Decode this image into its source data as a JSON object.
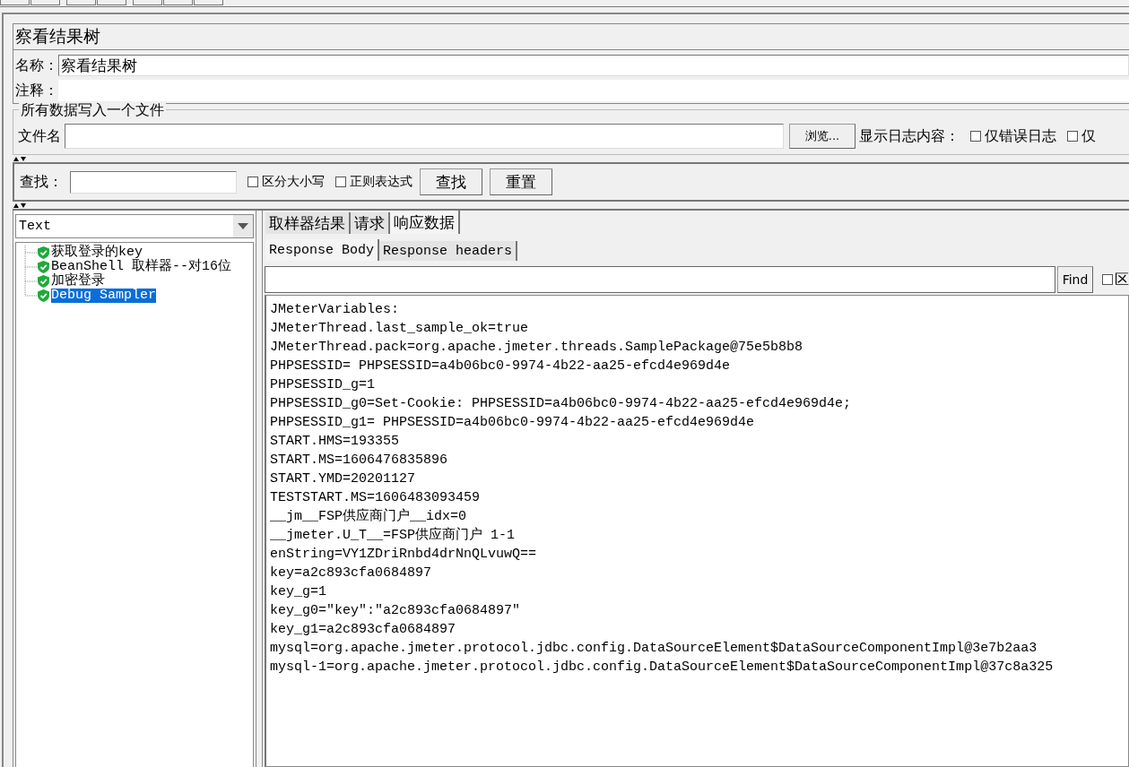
{
  "panel_title": "察看结果树",
  "name_field": {
    "label": "名称：",
    "value": "察看结果树"
  },
  "comment_field": {
    "label": "注释："
  },
  "file_group": {
    "legend": "所有数据写入一个文件",
    "label": "文件名",
    "browse_button": "浏览...",
    "log_label": "显示日志内容：",
    "options": [
      {
        "label": "仅错误日志",
        "checked": false
      },
      {
        "label": "仅",
        "checked": false
      }
    ]
  },
  "search": {
    "label": "查找：",
    "options": [
      {
        "label": "区分大小写",
        "checked": false
      },
      {
        "label": "正则表达式",
        "checked": false
      }
    ],
    "buttons": [
      "查找",
      "重置"
    ]
  },
  "renderer_select": {
    "value": "Text"
  },
  "tree": [
    {
      "label": "获取登录的key",
      "selected": false
    },
    {
      "label": "BeanShell 取样器--对16位",
      "selected": false
    },
    {
      "label": "加密登录",
      "selected": false
    },
    {
      "label": "Debug Sampler",
      "selected": true
    }
  ],
  "tabs": [
    {
      "label": "取样器结果",
      "selected": false
    },
    {
      "label": "请求",
      "selected": false
    },
    {
      "label": "响应数据",
      "selected": true
    }
  ],
  "subtabs": [
    {
      "label": "Response Body",
      "selected": true
    },
    {
      "label": "Response headers",
      "selected": false
    }
  ],
  "body_search": {
    "button": "Find",
    "options": [
      {
        "label": "区",
        "checked": false
      }
    ]
  },
  "response_lines": [
    "JMeterVariables:",
    "JMeterThread.last_sample_ok=true",
    "JMeterThread.pack=org.apache.jmeter.threads.SamplePackage@75e5b8b8",
    "PHPSESSID= PHPSESSID=a4b06bc0-9974-4b22-aa25-efcd4e969d4e",
    "PHPSESSID_g=1",
    "PHPSESSID_g0=Set-Cookie: PHPSESSID=a4b06bc0-9974-4b22-aa25-efcd4e969d4e;",
    "PHPSESSID_g1= PHPSESSID=a4b06bc0-9974-4b22-aa25-efcd4e969d4e",
    "START.HMS=193355",
    "START.MS=1606476835896",
    "START.YMD=20201127",
    "TESTSTART.MS=1606483093459",
    "__jm__FSP供应商门户__idx=0",
    "__jmeter.U_T__=FSP供应商门户 1-1",
    "enString=VY1ZDriRnbd4drNnQLvuwQ==",
    "key=a2c893cfa0684897",
    "key_g=1",
    "key_g0=\"key\":\"a2c893cfa0684897\"",
    "key_g1=a2c893cfa0684897",
    "mysql=org.apache.jmeter.protocol.jdbc.config.DataSourceElement$DataSourceComponentImpl@3e7b2aa3",
    "mysql-1=org.apache.jmeter.protocol.jdbc.config.DataSourceElement$DataSourceComponentImpl@37c8a325"
  ]
}
